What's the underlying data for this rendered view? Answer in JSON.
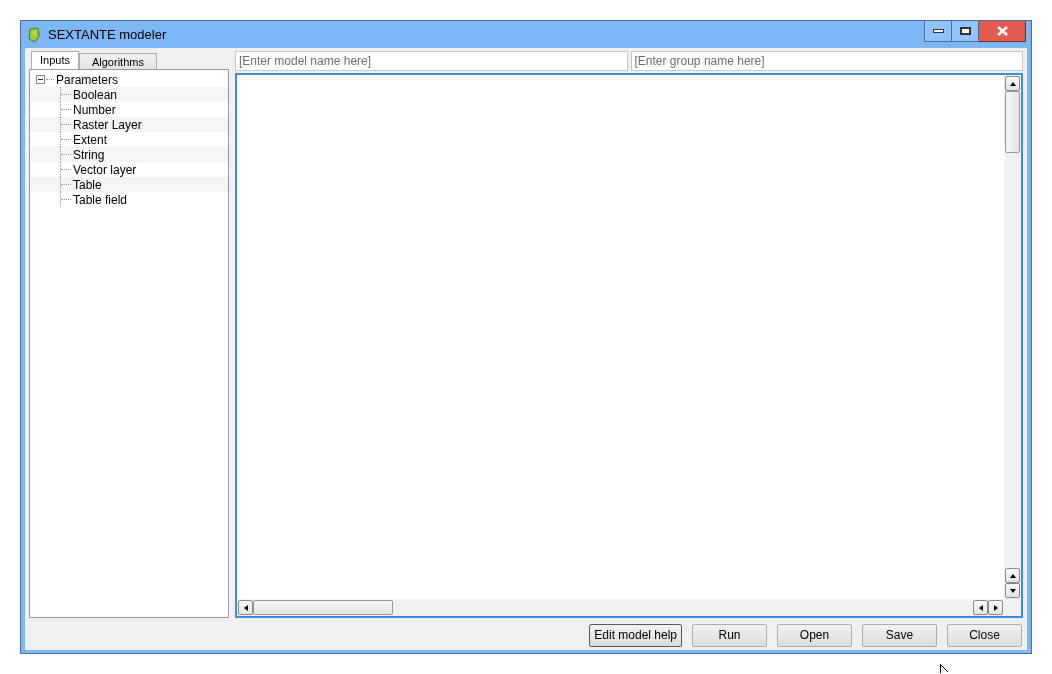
{
  "window": {
    "title": "SEXTANTE modeler"
  },
  "tabs": [
    {
      "label": "Inputs",
      "selected": true
    },
    {
      "label": "Algorithms",
      "selected": false
    }
  ],
  "tree": [
    {
      "label": "Parameters",
      "expanded": true,
      "children": [
        {
          "label": "Boolean"
        },
        {
          "label": "Number"
        },
        {
          "label": "Raster Layer"
        },
        {
          "label": "Extent"
        },
        {
          "label": "String"
        },
        {
          "label": "Vector layer"
        },
        {
          "label": "Table"
        },
        {
          "label": "Table field"
        }
      ]
    }
  ],
  "model_name": {
    "placeholder": "[Enter model name here]"
  },
  "group_name": {
    "placeholder": "[Enter group name here]"
  },
  "buttons": [
    {
      "label": "Edit model help",
      "kind": "default"
    },
    {
      "label": "Run",
      "kind": "normal"
    },
    {
      "label": "Open",
      "kind": "normal"
    },
    {
      "label": "Save",
      "kind": "normal"
    },
    {
      "label": "Close",
      "kind": "normal"
    }
  ]
}
